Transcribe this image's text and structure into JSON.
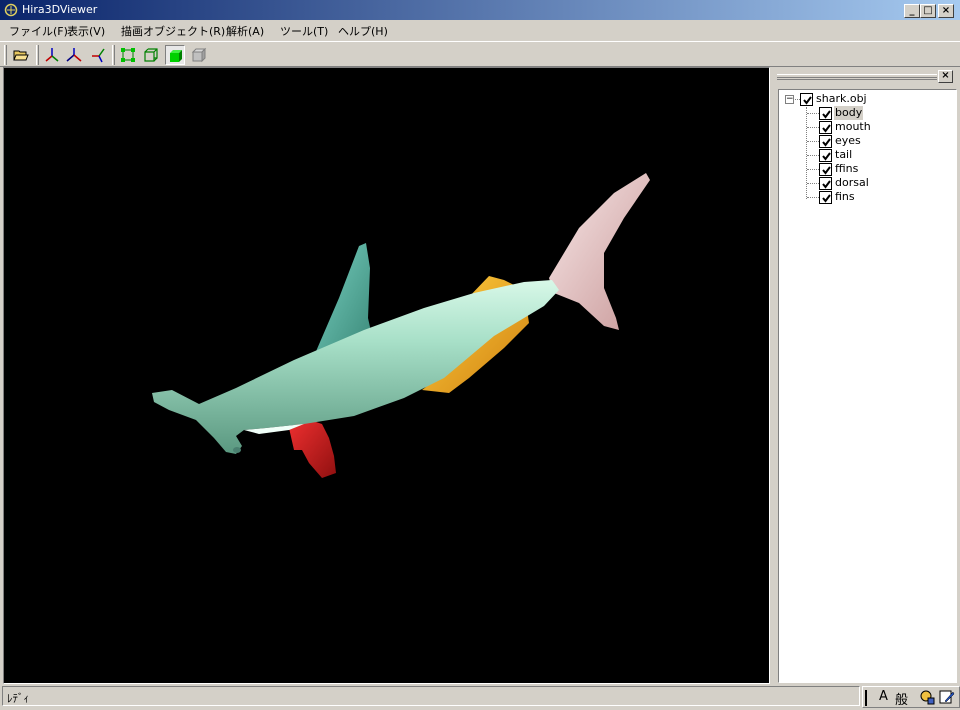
{
  "window": {
    "title": "Hira3DViewer",
    "min_label": "_",
    "max_label": "□",
    "close_label": "×"
  },
  "menu": {
    "items": [
      {
        "label": "ファイル(F)"
      },
      {
        "label": "表示(V)"
      },
      {
        "label": "描画オブジェクト(R)"
      },
      {
        "label": "解析(A)"
      },
      {
        "label": "ツール(T)"
      },
      {
        "label": "ヘルプ(H)"
      }
    ]
  },
  "toolbar": {
    "icons": [
      "open-folder-icon",
      "axes-xyz-icon",
      "axes-yz-icon",
      "axes-zx-icon",
      "vertex-mode-icon",
      "wireframe-mode-icon",
      "solid-mode-icon",
      "hidden-mode-icon"
    ]
  },
  "panel": {
    "close_label": "×",
    "tree": {
      "root": {
        "label": "shark.obj",
        "checked": true,
        "expanded": true,
        "expander": "−"
      },
      "children": [
        {
          "label": "body",
          "checked": true,
          "selected": true
        },
        {
          "label": "mouth",
          "checked": true
        },
        {
          "label": "eyes",
          "checked": true
        },
        {
          "label": "tail",
          "checked": true
        },
        {
          "label": "ffins",
          "checked": true
        },
        {
          "label": "dorsal",
          "checked": true
        },
        {
          "label": "fins",
          "checked": true
        }
      ]
    }
  },
  "scene": {
    "background": "#000000",
    "parts": {
      "body": {
        "color": "#a8e0c8"
      },
      "dorsal": {
        "color": "#5fb8a8"
      },
      "tail": {
        "color": "#e8c8c8"
      },
      "fins": {
        "color": "#f0b020"
      },
      "ffins": {
        "color": "#d82020"
      }
    }
  },
  "status": {
    "text": "ﾚﾃﾞｨ"
  },
  "ime": {
    "items": [
      "A",
      "般"
    ]
  }
}
